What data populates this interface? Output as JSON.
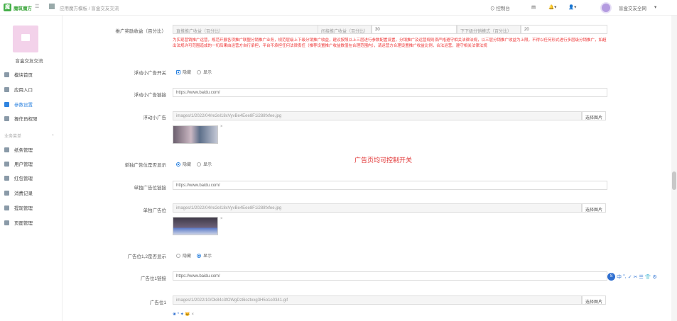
{
  "topbar": {
    "logo_text": "魔筑魔方",
    "breadcrumb": "应用魔方模板 / 盲盒交友交流",
    "console": "控制台",
    "username": "盲盒交友全网"
  },
  "sidebar": {
    "app_name": "盲盒交友交流",
    "items": [
      {
        "label": "模块首页",
        "icon": "home-icon"
      },
      {
        "label": "应用入口",
        "icon": "entry-icon"
      },
      {
        "label": "参数设置",
        "icon": "settings-icon",
        "active": true
      },
      {
        "label": "操作员权限",
        "icon": "permission-icon"
      }
    ],
    "group_label": "业务菜单",
    "group_items": [
      {
        "label": "纸条管理",
        "icon": "gear-icon"
      },
      {
        "label": "用户管理",
        "icon": "gear-icon"
      },
      {
        "label": "红包管理",
        "icon": "gear-icon"
      },
      {
        "label": "消费记录",
        "icon": "gear-icon"
      },
      {
        "label": "提现管理",
        "icon": "gear-icon"
      },
      {
        "label": "页面管理",
        "icon": "gear-icon"
      }
    ]
  },
  "form": {
    "promo": {
      "label": "推广奖励收益（百分比）",
      "fields": [
        {
          "placeholder": "直推推广收益（百分比）",
          "value": ""
        },
        {
          "placeholder": "间接推广收益（百分比）",
          "value": "30"
        },
        {
          "placeholder": "下下级分销模式（百分比）",
          "value": "20"
        }
      ]
    },
    "warning": "为实现营销推广运营，规范开展各项推广联盟分销推广业务，规范层级上下级分销推广收益，建议按照以上三层进行参数配置设置，分销推广及运营规则须严格遵守相关法律法规，以三层分销推广收益为上限，不得以任何形式进行多层级分销推广，如超出法规许可范围造成的一切后果由运营方自行承担，平台不承担任何法律责任（推荐设置推广收益数值在合理范围内），请运营方合理设置推广收益比例，合法运营，遵守相关法律法规",
    "float_switch": {
      "label": "浮动小广告开关",
      "options": [
        "隐藏",
        "显示"
      ],
      "selected": 0
    },
    "float_link": {
      "label": "浮动小广告链接",
      "value": "https://www.baidu.com/"
    },
    "float_ad": {
      "label": "浮动小广告",
      "value": "images/1/2022/04/re2eI18xVyvBe4Eee8F1i288fxfee.jpg",
      "button": "选择图片"
    },
    "single_show": {
      "label": "单独广告位是否显示",
      "options": [
        "隐藏",
        "显示"
      ],
      "selected": 0
    },
    "single_link": {
      "label": "单独广告位链接",
      "value": "https://www.baidu.com/"
    },
    "single_ad": {
      "label": "单独广告位",
      "value": "images/1/2022/04/re2eI18xVyvBe4Eee8F1i288fxfee.jpg",
      "button": "选择图片"
    },
    "ad12_show": {
      "label": "广告位1,2是否显示",
      "options": [
        "隐藏",
        "显示"
      ],
      "selected": 1
    },
    "ad_link": {
      "label": "广告位1链接",
      "value": "https://www.baidu.com/"
    },
    "ad1": {
      "label": "广告位1",
      "value": "images/1/2022/10/Ok84c3fOWgDz8ioztxxg3H5o1o0341.gif",
      "button": "选择图片"
    },
    "gif_caption": "*"
  },
  "overlay_text": "广告页均可控制开关",
  "ime": {
    "badge": "S",
    "items": [
      "中",
      "°,",
      "✓",
      "✂",
      "☰",
      "👕",
      "⚙"
    ]
  }
}
